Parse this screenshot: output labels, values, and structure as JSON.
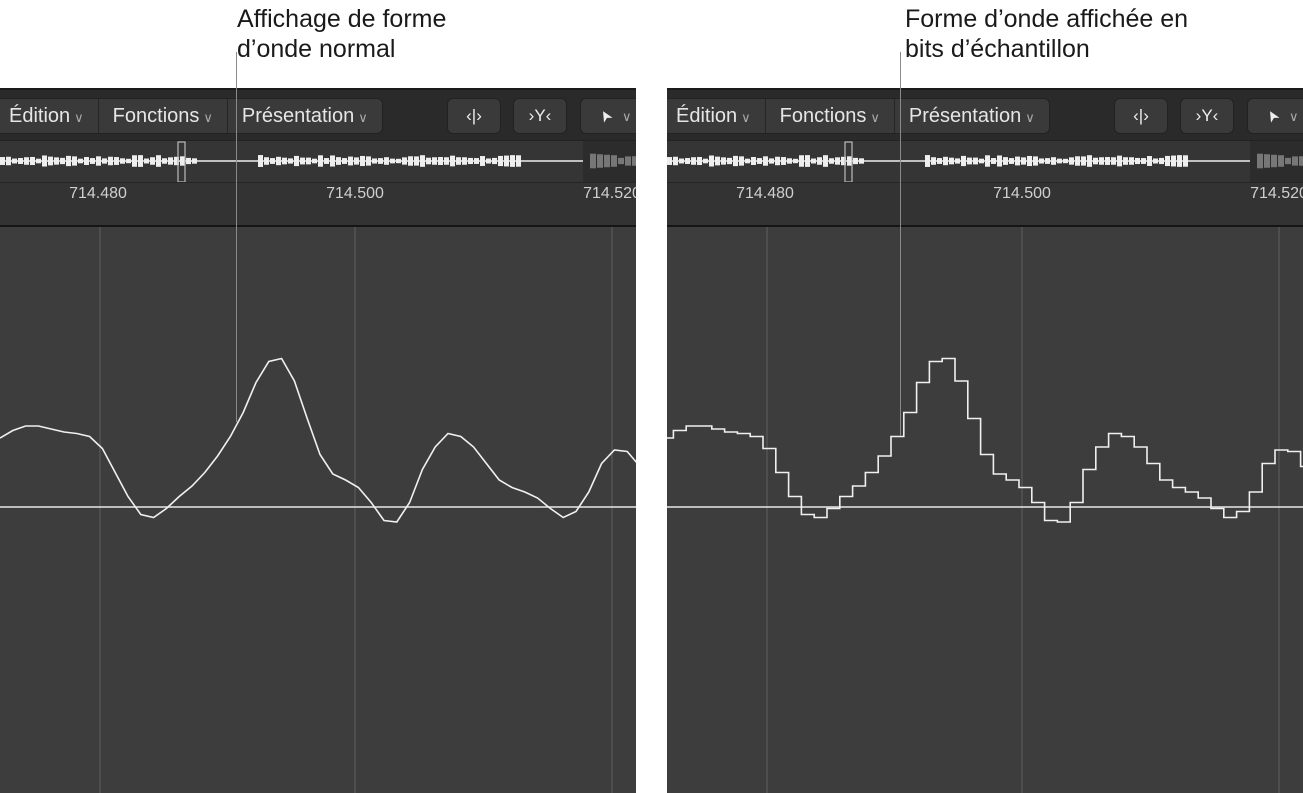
{
  "callouts": {
    "left": [
      "Affichage de forme",
      "d’onde normal"
    ],
    "right": [
      "Forme d’onde affichée en",
      "bits d’échantillon"
    ]
  },
  "toolbar": {
    "menus": [
      "Édition",
      "Fonctions",
      "Présentation"
    ],
    "chevron": "∨",
    "icons": [
      "split-icon",
      "catch-playhead-icon",
      "pointer-tool-icon"
    ],
    "icon_glyphs": [
      "‹|›",
      "›Y‹",
      "➤"
    ]
  },
  "ruler": {
    "labels": [
      "714.480",
      "714.500",
      "714.520"
    ]
  },
  "colors": {
    "background": "#3d3d3d",
    "waveform": "#f0f0f0",
    "grid": "#555555"
  },
  "waveform": {
    "samples": [
      0.46,
      0.51,
      0.54,
      0.54,
      0.52,
      0.5,
      0.49,
      0.47,
      0.39,
      0.23,
      0.07,
      -0.05,
      -0.07,
      -0.01,
      0.07,
      0.14,
      0.23,
      0.34,
      0.47,
      0.63,
      0.83,
      0.97,
      0.99,
      0.84,
      0.59,
      0.35,
      0.22,
      0.18,
      0.13,
      0.03,
      -0.09,
      -0.1,
      0.03,
      0.25,
      0.4,
      0.49,
      0.47,
      0.4,
      0.29,
      0.18,
      0.13,
      0.1,
      0.06,
      -0.01,
      -0.07,
      -0.03,
      0.1,
      0.29,
      0.38,
      0.37,
      0.27
    ],
    "modes": [
      "normal",
      "sample-bits"
    ]
  }
}
